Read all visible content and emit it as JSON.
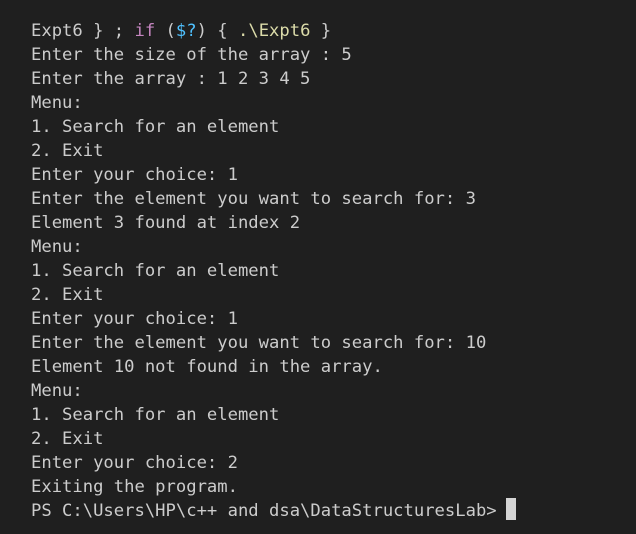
{
  "terminal": {
    "command_line": {
      "seg1": "Expt6 } ; ",
      "seg2": "if",
      "seg3": " (",
      "seg4": "$?",
      "seg5": ") { ",
      "seg6": ".\\Expt6",
      "seg7": " }"
    },
    "lines": [
      "Enter the size of the array : 5",
      "Enter the array : 1 2 3 4 5",
      "Menu:",
      "1. Search for an element",
      "2. Exit",
      "Enter your choice: 1",
      "Enter the element you want to search for: 3",
      "Element 3 found at index 2",
      "Menu:",
      "1. Search for an element",
      "2. Exit",
      "Enter your choice: 1",
      "Enter the element you want to search for: 10",
      "Element 10 not found in the array.",
      "Menu:",
      "1. Search for an element",
      "2. Exit",
      "Enter your choice: 2",
      "Exiting the program."
    ],
    "prompt": "PS C:\\Users\\HP\\c++ and dsa\\DataStructuresLab>",
    "colors": {
      "background": "#1f1f1f",
      "text": "#cccccc",
      "keyword": "#c586c0",
      "variable": "#4fc1ff",
      "path": "#dcdcaa",
      "cursor": "#d4d4d4"
    }
  }
}
